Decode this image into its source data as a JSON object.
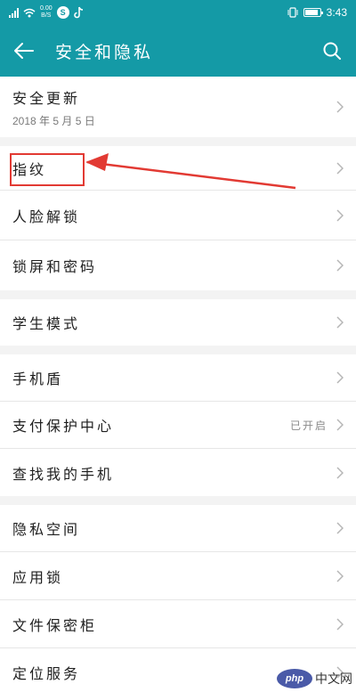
{
  "status_bar": {
    "net_speed_top": "0.00",
    "net_speed_bottom": "B/S",
    "app_badge": "S",
    "time": "3:43"
  },
  "header": {
    "title": "安全和隐私",
    "back_icon": "arrow-left-icon",
    "search_icon": "search-icon"
  },
  "groups": [
    [
      {
        "label": "安全更新",
        "sub": "2018 年 5 月 5 日"
      }
    ],
    [
      {
        "label": "指纹"
      },
      {
        "label": "人脸解锁"
      },
      {
        "label": "锁屏和密码"
      }
    ],
    [
      {
        "label": "学生模式"
      }
    ],
    [
      {
        "label": "手机盾"
      },
      {
        "label": "支付保护中心",
        "value": "已开启"
      },
      {
        "label": "查找我的手机"
      }
    ],
    [
      {
        "label": "隐私空间"
      },
      {
        "label": "应用锁"
      },
      {
        "label": "文件保密柜"
      },
      {
        "label": "定位服务"
      }
    ]
  ],
  "annotation": {
    "highlight_color": "#e23a33"
  },
  "watermark": {
    "logo_text": "php",
    "text": "中文网"
  },
  "colors": {
    "accent": "#149aa6",
    "background": "#f3f3f3"
  }
}
